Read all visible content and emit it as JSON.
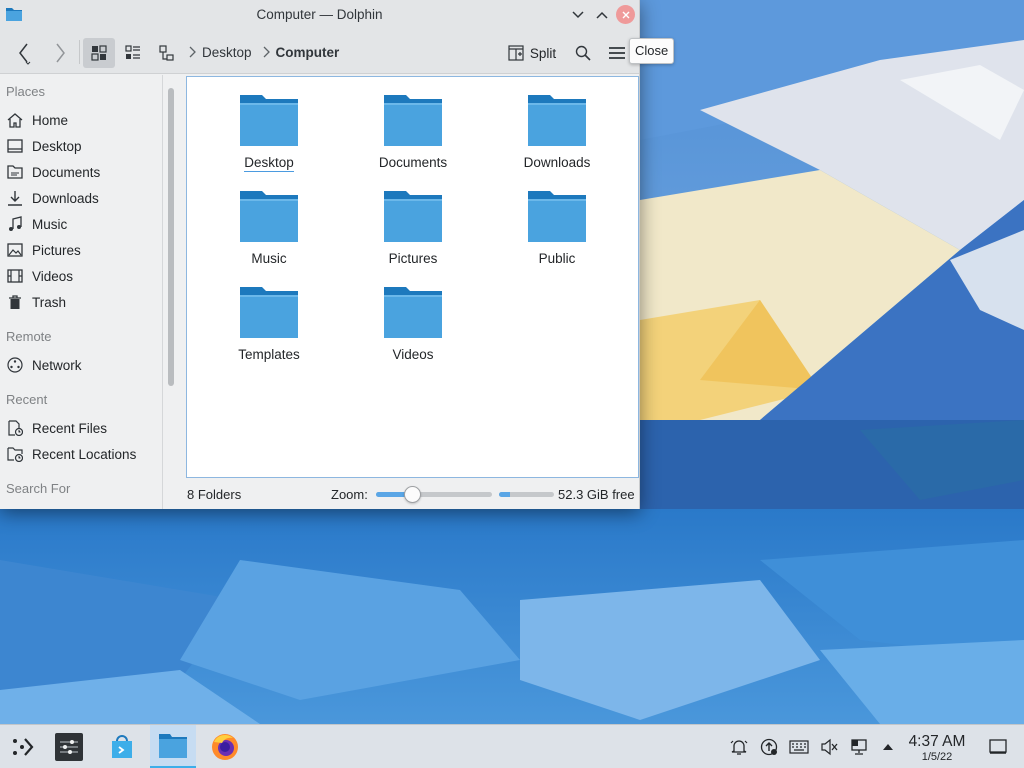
{
  "window": {
    "title": "Computer — Dolphin",
    "tooltip": "Close"
  },
  "toolbar": {
    "split_label": "Split",
    "breadcrumb": [
      "Desktop",
      "Computer"
    ]
  },
  "sidebar": {
    "sections": {
      "places": "Places",
      "remote": "Remote",
      "recent": "Recent",
      "search": "Search For"
    },
    "places": [
      {
        "label": "Home",
        "icon": "home-icon"
      },
      {
        "label": "Desktop",
        "icon": "desktop-icon"
      },
      {
        "label": "Documents",
        "icon": "documents-icon"
      },
      {
        "label": "Downloads",
        "icon": "downloads-icon"
      },
      {
        "label": "Music",
        "icon": "music-icon"
      },
      {
        "label": "Pictures",
        "icon": "pictures-icon"
      },
      {
        "label": "Videos",
        "icon": "videos-icon"
      },
      {
        "label": "Trash",
        "icon": "trash-icon"
      }
    ],
    "remote": [
      {
        "label": "Network",
        "icon": "network-icon"
      }
    ],
    "recent": [
      {
        "label": "Recent Files",
        "icon": "recent-files-icon"
      },
      {
        "label": "Recent Locations",
        "icon": "recent-locations-icon"
      }
    ]
  },
  "folders": [
    "Desktop",
    "Documents",
    "Downloads",
    "Music",
    "Pictures",
    "Public",
    "Templates",
    "Videos"
  ],
  "status": {
    "summary": "8 Folders",
    "zoom_label": "Zoom:",
    "zoom_level": 0.28,
    "space_used_fraction": 0.2,
    "free_space": "52.3 GiB free"
  },
  "taskbar": {
    "time": "4:37 AM",
    "date": "1/5/22"
  },
  "colors": {
    "accent": "#3daee9",
    "folder": "#4aa3df",
    "folder_tab": "#1d79bd"
  }
}
